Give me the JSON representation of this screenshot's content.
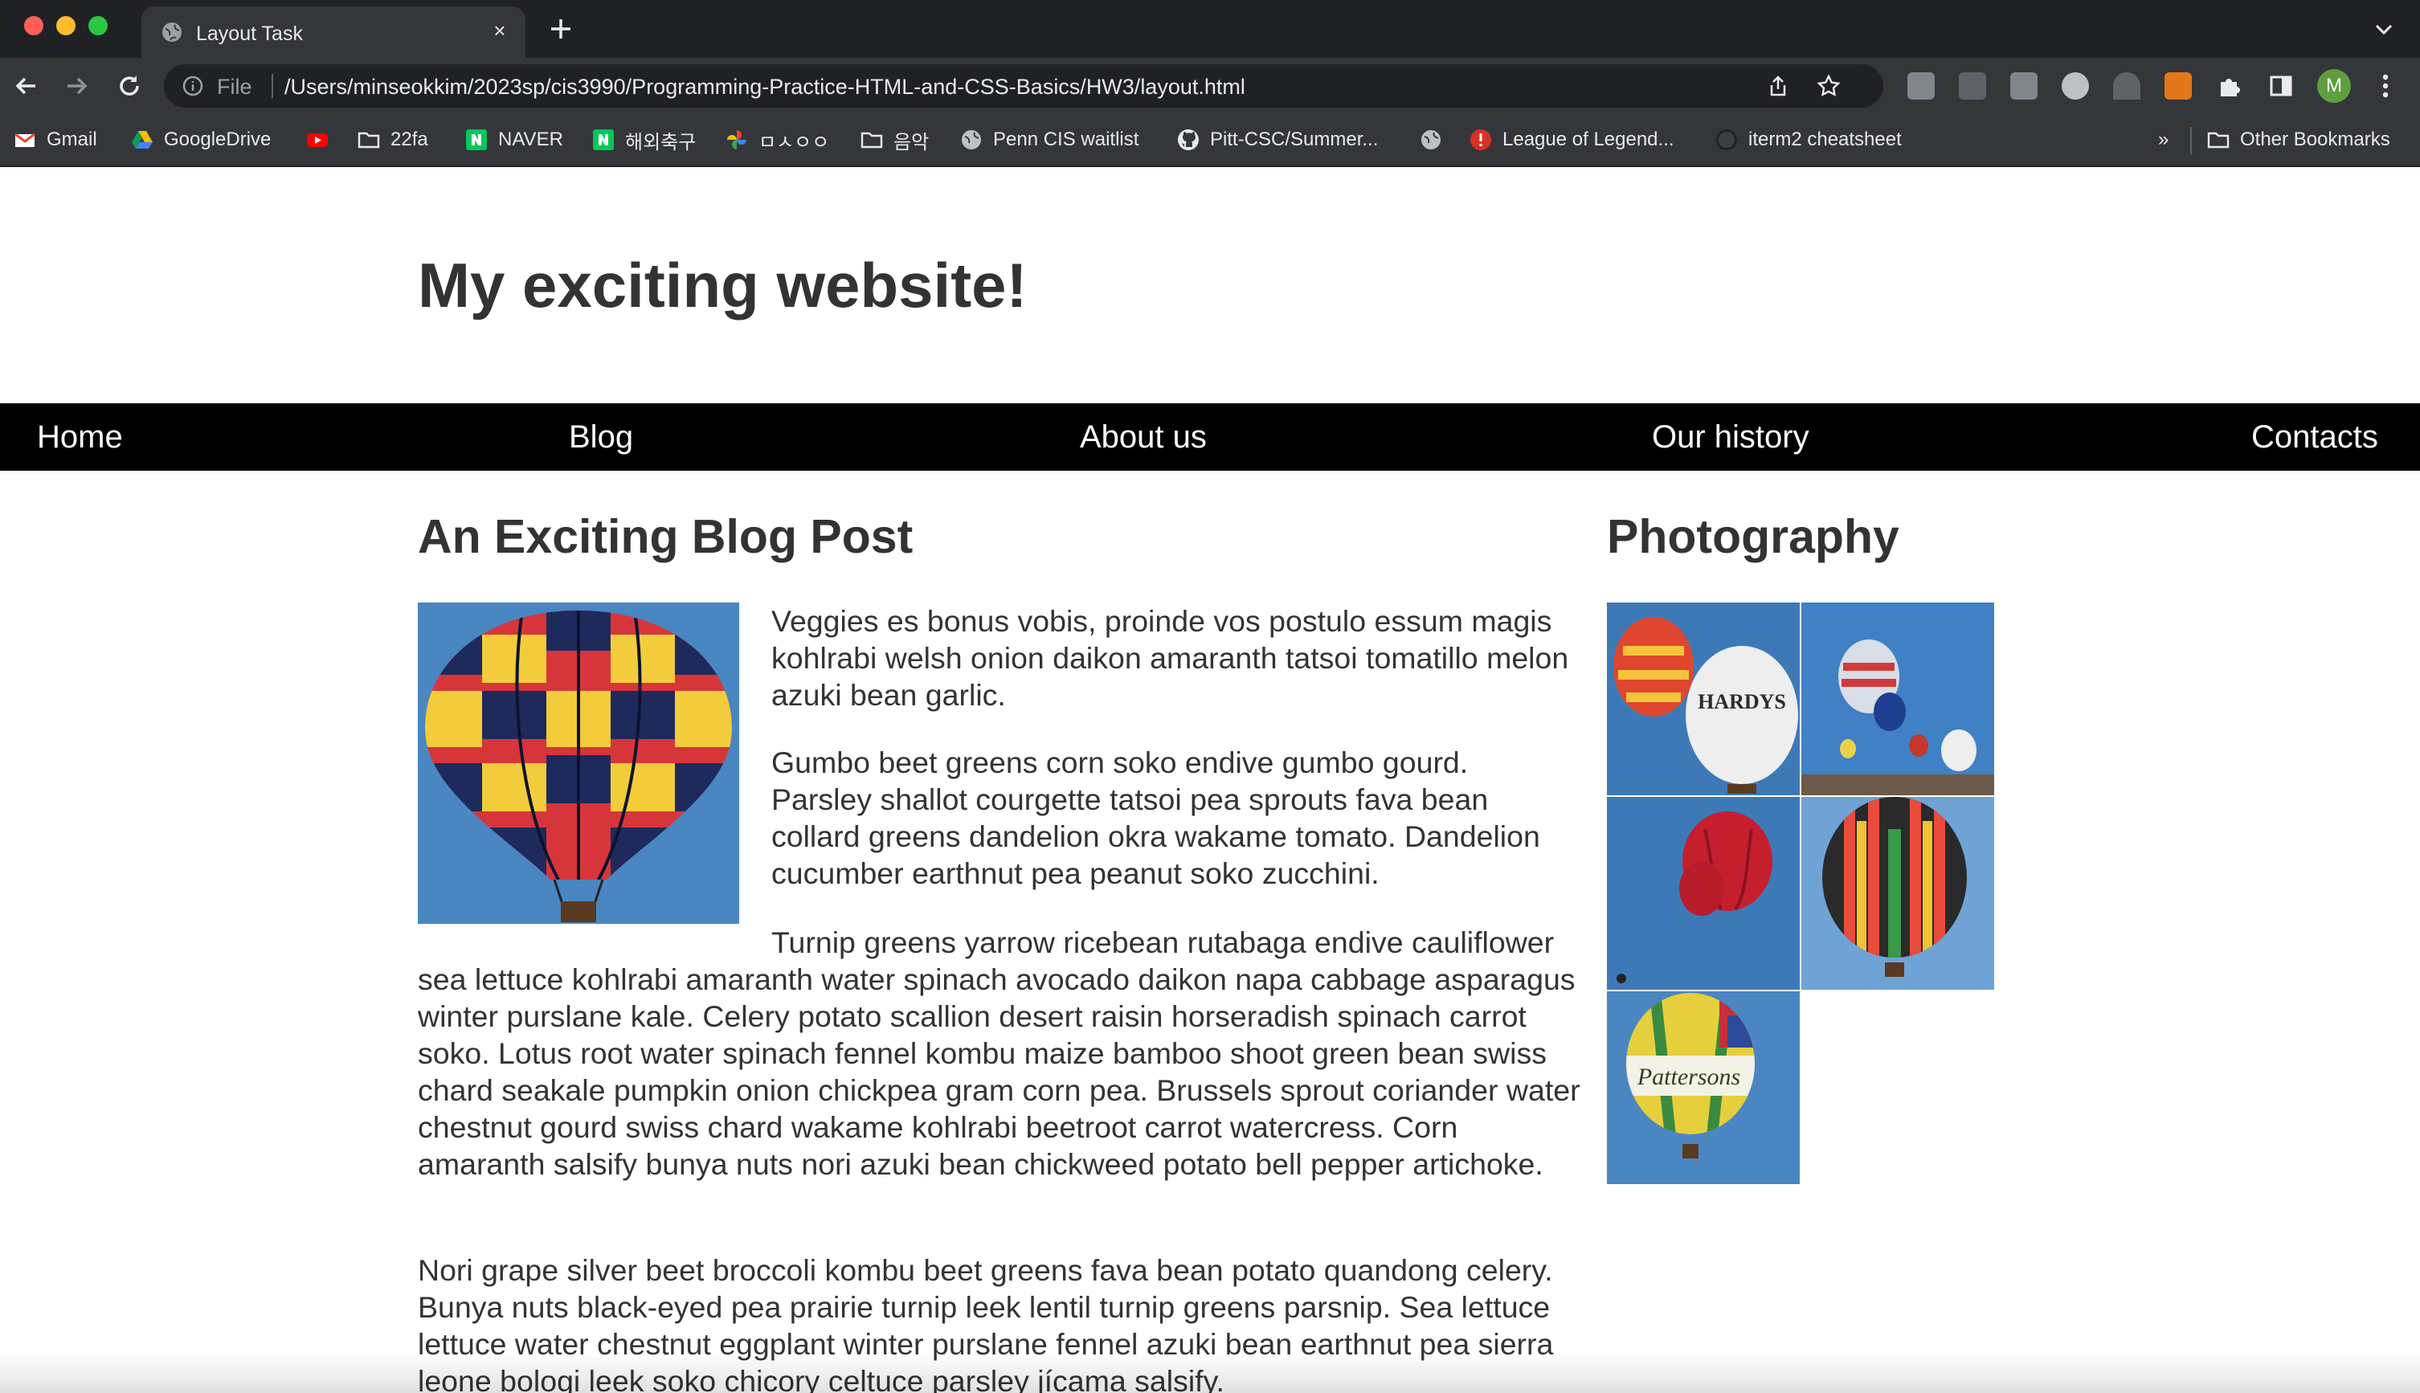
{
  "browser": {
    "tab_title": "Layout Task",
    "url_scheme": "File",
    "url": "/Users/minseokkim/2023sp/cis3990/Programming-Practice-HTML-and-CSS-Basics/HW3/layout.html",
    "avatar_letter": "M",
    "bookmarks": [
      {
        "label": "Gmail",
        "icon": "gmail-icon"
      },
      {
        "label": "GoogleDrive",
        "icon": "google-drive-icon"
      },
      {
        "label": "",
        "icon": "youtube-icon"
      },
      {
        "label": "22fa",
        "icon": "folder-icon"
      },
      {
        "label": "NAVER",
        "icon": "naver-icon"
      },
      {
        "label": "해외축구",
        "icon": "naver-icon"
      },
      {
        "label": "ㅁㅅㅇㅇ",
        "icon": "google-photos-icon"
      },
      {
        "label": "음악",
        "icon": "folder-icon"
      },
      {
        "label": "Penn CIS waitlist",
        "icon": "globe-icon"
      },
      {
        "label": "Pitt-CSC/Summer...",
        "icon": "github-icon"
      },
      {
        "label": "",
        "icon": "globe-icon"
      },
      {
        "label": "League of Legend...",
        "icon": "alert-icon"
      },
      {
        "label": "iterm2 cheatsheet",
        "icon": "github-icon"
      }
    ],
    "overflow_label": "»",
    "other_bookmarks": "Other Bookmarks"
  },
  "site": {
    "title": "My exciting website!",
    "nav": [
      "Home",
      "Blog",
      "About us",
      "Our history",
      "Contacts"
    ]
  },
  "post": {
    "heading": "An Exciting Blog Post",
    "image": "hot-air-balloon",
    "p1": "Veggies es bonus vobis, proinde vos postulo essum magis kohlrabi welsh onion daikon amaranth tatsoi tomatillo melon azuki bean garlic.",
    "p2": "Gumbo beet greens corn soko endive gumbo gourd. Parsley shallot courgette tatsoi pea sprouts fava bean collard greens dandelion okra wakame tomato. Dandelion cucumber earthnut pea peanut soko zucchini.",
    "p3_first": "Turnip greens yarrow ricebean rutabaga endive cauliflower",
    "p3_rest": "sea lettuce kohlrabi amaranth water spinach avocado daikon napa cabbage asparagus winter purslane kale. Celery potato scallion desert raisin horseradish spinach carrot soko. Lotus root water spinach fennel kombu maize bamboo shoot green bean swiss chard seakale pumpkin onion chickpea gram corn pea. Brussels sprout coriander water chestnut gourd swiss chard wakame kohlrabi beetroot carrot watercress. Corn amaranth salsify bunya nuts nori azuki bean chickweed potato bell pepper artichoke.",
    "p4": "Nori grape silver beet broccoli kombu beet greens fava bean potato quandong celery. Bunya nuts black-eyed pea prairie turnip leek lentil turnip greens parsnip. Sea lettuce lettuce water chestnut eggplant winter purslane fennel azuki bean earthnut pea sierra leone bologi leek soko chicory celtuce parsley jícama salsify."
  },
  "sidebar": {
    "heading": "Photography",
    "photos": [
      {
        "name": "photo-hardys-balloons",
        "text": "HARDYS"
      },
      {
        "name": "photo-balloon-fiesta",
        "text": ""
      },
      {
        "name": "photo-red-virgin-balloons",
        "text": ""
      },
      {
        "name": "photo-rainbow-balloon",
        "text": ""
      },
      {
        "name": "photo-pattersons-balloon",
        "text": "Pattersons"
      }
    ]
  }
}
